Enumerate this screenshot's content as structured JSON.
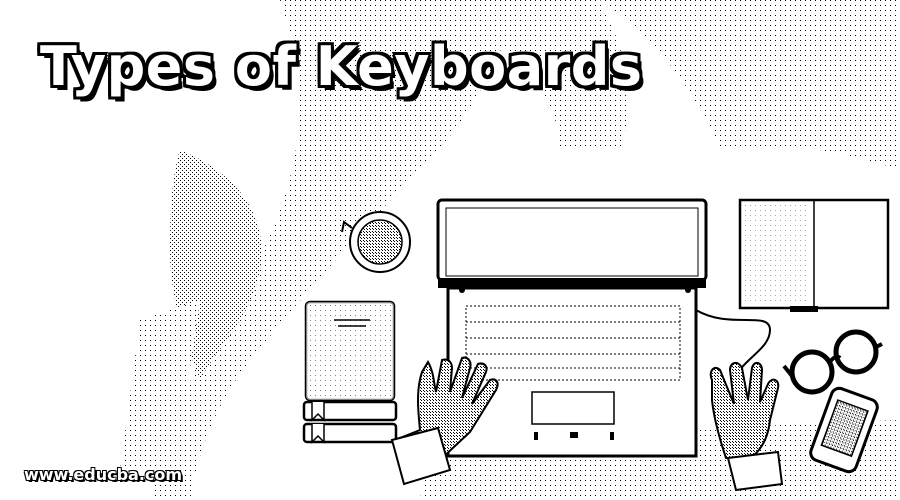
{
  "banner": {
    "title": "Types of Keyboards",
    "website": "www.educba.com"
  },
  "colors": {
    "ink": "#000000",
    "paper": "#ffffff",
    "stipple": "#555555"
  },
  "icons": [
    "coffee-cup-icon",
    "laptop-icon",
    "open-book-icon",
    "book-stack-icon",
    "glasses-icon",
    "smartphone-icon",
    "hand-icon"
  ]
}
